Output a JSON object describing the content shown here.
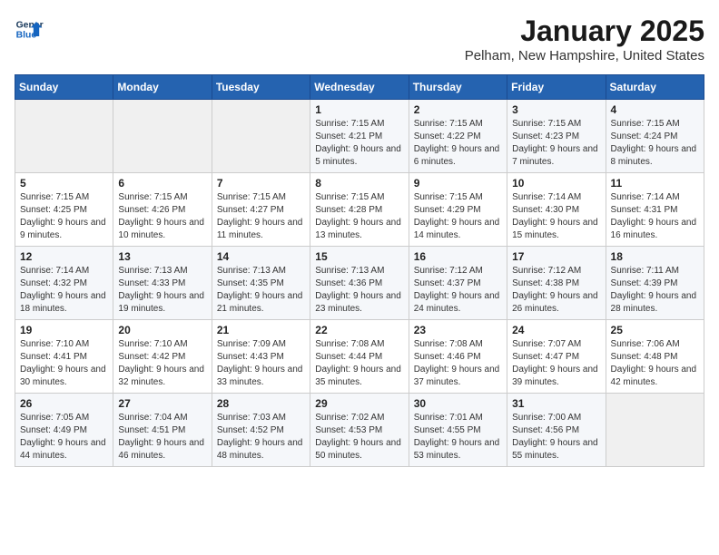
{
  "logo": {
    "line1": "General",
    "line2": "Blue"
  },
  "title": "January 2025",
  "location": "Pelham, New Hampshire, United States",
  "weekdays": [
    "Sunday",
    "Monday",
    "Tuesday",
    "Wednesday",
    "Thursday",
    "Friday",
    "Saturday"
  ],
  "weeks": [
    [
      {
        "day": "",
        "empty": true
      },
      {
        "day": "",
        "empty": true
      },
      {
        "day": "",
        "empty": true
      },
      {
        "day": "1",
        "sunrise": "7:15 AM",
        "sunset": "4:21 PM",
        "daylight": "9 hours and 5 minutes."
      },
      {
        "day": "2",
        "sunrise": "7:15 AM",
        "sunset": "4:22 PM",
        "daylight": "9 hours and 6 minutes."
      },
      {
        "day": "3",
        "sunrise": "7:15 AM",
        "sunset": "4:23 PM",
        "daylight": "9 hours and 7 minutes."
      },
      {
        "day": "4",
        "sunrise": "7:15 AM",
        "sunset": "4:24 PM",
        "daylight": "9 hours and 8 minutes."
      }
    ],
    [
      {
        "day": "5",
        "sunrise": "7:15 AM",
        "sunset": "4:25 PM",
        "daylight": "9 hours and 9 minutes."
      },
      {
        "day": "6",
        "sunrise": "7:15 AM",
        "sunset": "4:26 PM",
        "daylight": "9 hours and 10 minutes."
      },
      {
        "day": "7",
        "sunrise": "7:15 AM",
        "sunset": "4:27 PM",
        "daylight": "9 hours and 11 minutes."
      },
      {
        "day": "8",
        "sunrise": "7:15 AM",
        "sunset": "4:28 PM",
        "daylight": "9 hours and 13 minutes."
      },
      {
        "day": "9",
        "sunrise": "7:15 AM",
        "sunset": "4:29 PM",
        "daylight": "9 hours and 14 minutes."
      },
      {
        "day": "10",
        "sunrise": "7:14 AM",
        "sunset": "4:30 PM",
        "daylight": "9 hours and 15 minutes."
      },
      {
        "day": "11",
        "sunrise": "7:14 AM",
        "sunset": "4:31 PM",
        "daylight": "9 hours and 16 minutes."
      }
    ],
    [
      {
        "day": "12",
        "sunrise": "7:14 AM",
        "sunset": "4:32 PM",
        "daylight": "9 hours and 18 minutes."
      },
      {
        "day": "13",
        "sunrise": "7:13 AM",
        "sunset": "4:33 PM",
        "daylight": "9 hours and 19 minutes."
      },
      {
        "day": "14",
        "sunrise": "7:13 AM",
        "sunset": "4:35 PM",
        "daylight": "9 hours and 21 minutes."
      },
      {
        "day": "15",
        "sunrise": "7:13 AM",
        "sunset": "4:36 PM",
        "daylight": "9 hours and 23 minutes."
      },
      {
        "day": "16",
        "sunrise": "7:12 AM",
        "sunset": "4:37 PM",
        "daylight": "9 hours and 24 minutes."
      },
      {
        "day": "17",
        "sunrise": "7:12 AM",
        "sunset": "4:38 PM",
        "daylight": "9 hours and 26 minutes."
      },
      {
        "day": "18",
        "sunrise": "7:11 AM",
        "sunset": "4:39 PM",
        "daylight": "9 hours and 28 minutes."
      }
    ],
    [
      {
        "day": "19",
        "sunrise": "7:10 AM",
        "sunset": "4:41 PM",
        "daylight": "9 hours and 30 minutes."
      },
      {
        "day": "20",
        "sunrise": "7:10 AM",
        "sunset": "4:42 PM",
        "daylight": "9 hours and 32 minutes."
      },
      {
        "day": "21",
        "sunrise": "7:09 AM",
        "sunset": "4:43 PM",
        "daylight": "9 hours and 33 minutes."
      },
      {
        "day": "22",
        "sunrise": "7:08 AM",
        "sunset": "4:44 PM",
        "daylight": "9 hours and 35 minutes."
      },
      {
        "day": "23",
        "sunrise": "7:08 AM",
        "sunset": "4:46 PM",
        "daylight": "9 hours and 37 minutes."
      },
      {
        "day": "24",
        "sunrise": "7:07 AM",
        "sunset": "4:47 PM",
        "daylight": "9 hours and 39 minutes."
      },
      {
        "day": "25",
        "sunrise": "7:06 AM",
        "sunset": "4:48 PM",
        "daylight": "9 hours and 42 minutes."
      }
    ],
    [
      {
        "day": "26",
        "sunrise": "7:05 AM",
        "sunset": "4:49 PM",
        "daylight": "9 hours and 44 minutes."
      },
      {
        "day": "27",
        "sunrise": "7:04 AM",
        "sunset": "4:51 PM",
        "daylight": "9 hours and 46 minutes."
      },
      {
        "day": "28",
        "sunrise": "7:03 AM",
        "sunset": "4:52 PM",
        "daylight": "9 hours and 48 minutes."
      },
      {
        "day": "29",
        "sunrise": "7:02 AM",
        "sunset": "4:53 PM",
        "daylight": "9 hours and 50 minutes."
      },
      {
        "day": "30",
        "sunrise": "7:01 AM",
        "sunset": "4:55 PM",
        "daylight": "9 hours and 53 minutes."
      },
      {
        "day": "31",
        "sunrise": "7:00 AM",
        "sunset": "4:56 PM",
        "daylight": "9 hours and 55 minutes."
      },
      {
        "day": "",
        "empty": true
      }
    ]
  ],
  "labels": {
    "sunrise": "Sunrise:",
    "sunset": "Sunset:",
    "daylight": "Daylight:"
  }
}
